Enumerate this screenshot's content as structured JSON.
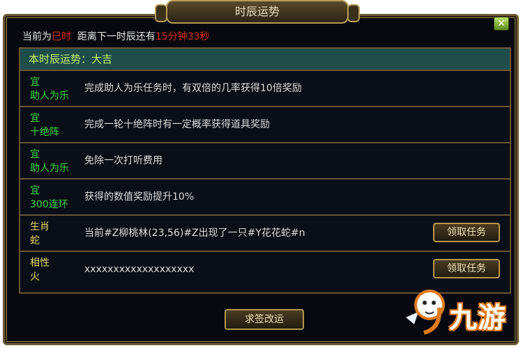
{
  "window": {
    "title": "时辰运势",
    "close_label": "✕"
  },
  "status": {
    "prefix": "当前为",
    "current_hour": "巳时",
    "middle": "距离下一时辰还有",
    "countdown": "15分钟33秒"
  },
  "fortune": {
    "header": "本时辰运势：大吉",
    "rows": [
      {
        "label_top": "宜",
        "label_bottom": "助人为乐",
        "desc": "完成助人为乐任务时，有双倍的几率获得10倍奖励",
        "color": "#39d94a"
      },
      {
        "label_top": "宜",
        "label_bottom": "十绝阵",
        "desc": "完成一轮十绝阵时有一定概率获得道具奖励",
        "color": "#39d94a"
      },
      {
        "label_top": "宜",
        "label_bottom": "助人为乐",
        "desc": "免除一次打听费用",
        "color": "#39d94a"
      },
      {
        "label_top": "宜",
        "label_bottom": "300连环",
        "desc": "获得的数值奖励提升10%",
        "color": "#39d94a"
      },
      {
        "label_top": "生肖",
        "label_bottom": "蛇",
        "desc": "当前#Z柳桃林(23,56)#Z出现了一只#Y花花蛇#n",
        "color": "#e8d86a",
        "button": "领取任务"
      },
      {
        "label_top": "相性",
        "label_bottom": "火",
        "desc": "xxxxxxxxxxxxxxxxxxx",
        "color": "#e8d86a",
        "button": "领取任务"
      }
    ]
  },
  "footer": {
    "button": "求签改运"
  },
  "watermark": {
    "text": "九游"
  }
}
